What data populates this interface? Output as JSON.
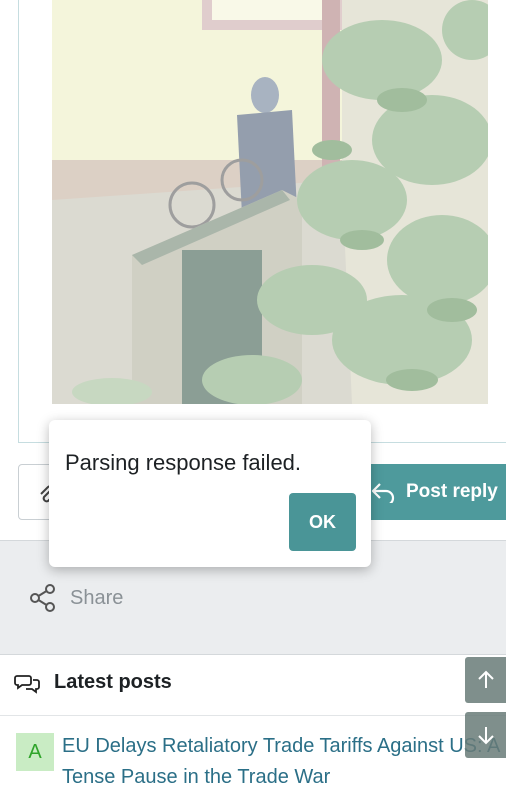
{
  "post": {
    "reply_button_label": "Post reply"
  },
  "share": {
    "label": "Share"
  },
  "latest_posts": {
    "heading": "Latest posts",
    "items": [
      {
        "avatar_letter": "A",
        "title": "EU Delays Retaliatory Trade Tariffs Against US: A Tense Pause in the Trade War"
      }
    ]
  },
  "dialog": {
    "message": "Parsing response failed.",
    "ok_label": "OK"
  },
  "colors": {
    "accent": "#4e9a9c",
    "link": "#2b6f87",
    "avatar_bg": "#c9ecc4",
    "avatar_fg": "#2fa42a"
  }
}
